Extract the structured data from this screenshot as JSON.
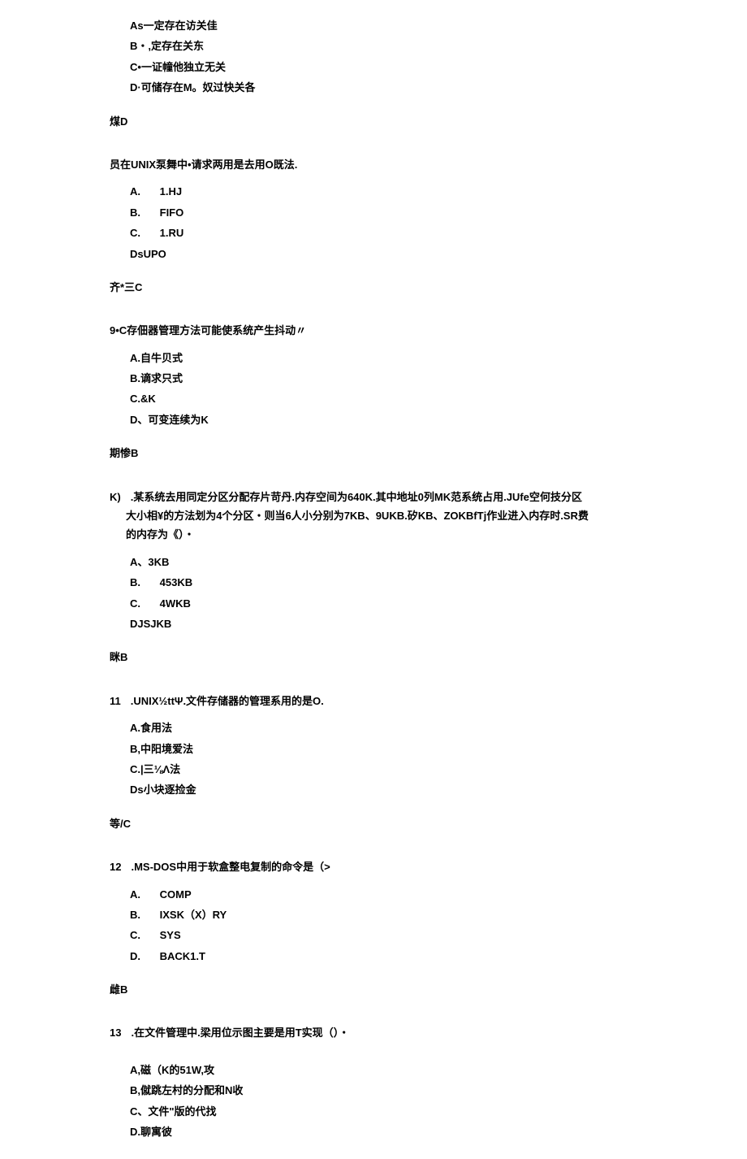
{
  "q7": {
    "options": {
      "a": "As一定存在访关佳",
      "b": "B・,定存在关东",
      "c": "C•一证幢他独立无关",
      "d": "D·可储存在M。奴过快关各"
    },
    "answer": "煤D"
  },
  "q8": {
    "text": "员在UNIX泵舞中•请求两用是去用O既法.",
    "options": {
      "a_label": "A.",
      "a_text": "1.HJ",
      "b_label": "B.",
      "b_text": "FIFO",
      "c_label": "C.",
      "c_text": "1.RU",
      "d": "DsUPO"
    },
    "answer": "齐*三C"
  },
  "q9": {
    "text": "9•C存佃器管理方法可能使系统产生抖动〃",
    "options": {
      "a": "A.自牛贝式",
      "b": "B.谪求只式",
      "c": "C.&K",
      "d": "D、可变连续为K"
    },
    "answer": "期惨B"
  },
  "q10": {
    "prefix": "K)",
    "text_line1": ".某系统去用同定分区分配存片苛丹.内存空间为640K.其中地址0列MK范系统占用.JUfe空何技分区",
    "text_line2": "大小相¥的方法划为4个分区・则当6人小分别为7KB、9UKB.矽KB、ZOKBfTj作业进入内存时.SR费",
    "text_line3": "的内存为《）・",
    "options": {
      "a": "A、3KB",
      "b_label": "B.",
      "b_text": "453KB",
      "c_label": "C.",
      "c_text": "4WKB",
      "d": "DJSJKB"
    },
    "answer": "眯B"
  },
  "q11": {
    "prefix": "11",
    "text": ".UNIX½ttΨ.文件存储器的管理系用的是O.",
    "options": {
      "a": "A.食用法",
      "b": "B,中阳境爱法",
      "c": "C.|三⅛Λ法",
      "d": "Ds小块逐捡金"
    },
    "answer": "等/C"
  },
  "q12": {
    "prefix": "12",
    "text": ".MS-DOS中用于软盒整电复制的命令是（>",
    "options": {
      "a_label": "A.",
      "a_text": "COMP",
      "b_label": "B.",
      "b_text": "IXSK（X）RY",
      "c_label": "C.",
      "c_text": "SYS",
      "d_label": "D.",
      "d_text": "BACK1.T"
    },
    "answer": "雌B"
  },
  "q13": {
    "prefix": "13",
    "text": ".在文件管理中.梁用位示图主要是用T实现（）・",
    "options": {
      "a": "A,磁（K的51W,攻",
      "b": "B,僦跳左村的分配和N收",
      "c": "C、文件\"版的代找",
      "d": "D.聊寓彼"
    }
  }
}
